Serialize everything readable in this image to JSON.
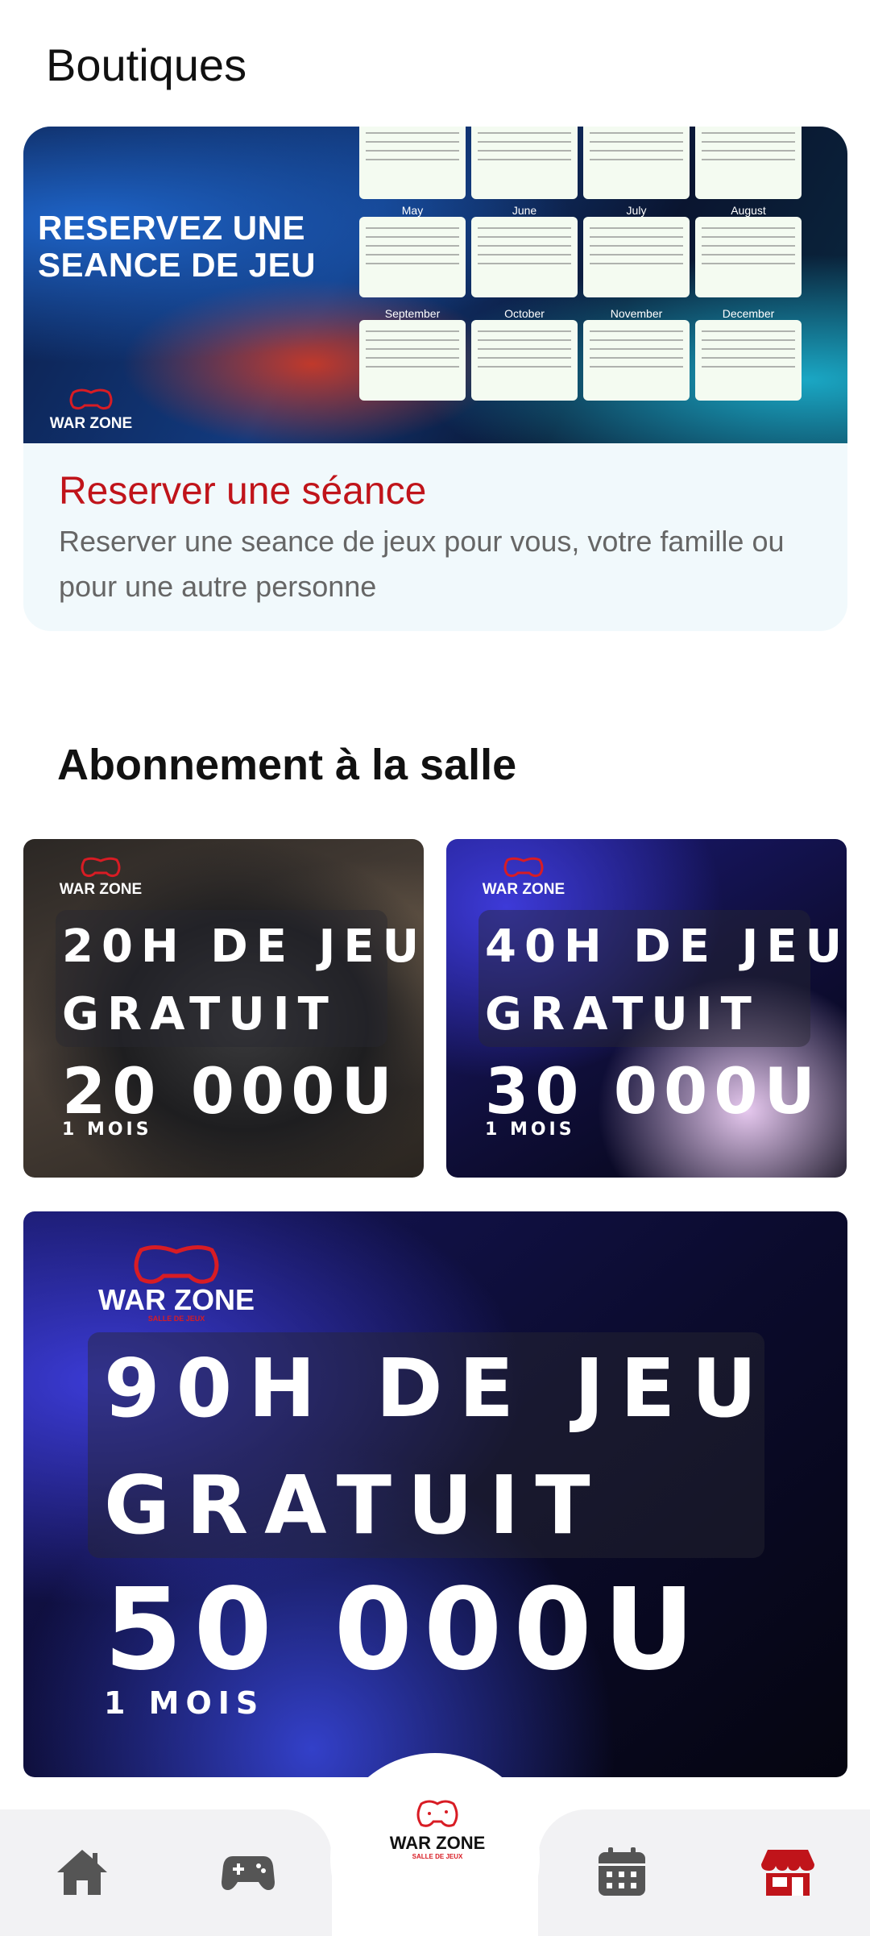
{
  "header": {
    "title": "Boutiques"
  },
  "reservation": {
    "banner_line1": "RESERVEZ UNE",
    "banner_line2": "SEANCE DE JEU",
    "brand": "WAR ZONE",
    "months": [
      "May",
      "June",
      "July",
      "August",
      "September",
      "October",
      "November",
      "December"
    ],
    "title": "Reserver une séance",
    "description": "Reserver une seance de jeux pour vous, votre famille ou pour une autre personne"
  },
  "subscriptions": {
    "section_title": "Abonnement à la salle",
    "plans": [
      {
        "brand": "WAR ZONE",
        "line1": "20H DE JEU",
        "line2": "GRATUIT",
        "price": "20 000U",
        "duration": "1 MOIS"
      },
      {
        "brand": "WAR ZONE",
        "line1": "40H DE JEU",
        "line2": "GRATUIT",
        "price": "30 000U",
        "duration": "1 MOIS"
      },
      {
        "brand": "WAR ZONE",
        "brand_sub": "SALLE DE JEUX",
        "line1": "90H DE JEU",
        "line2": "GRATUIT",
        "price": "50 000U",
        "duration": "1 MOIS"
      }
    ]
  },
  "nav": {
    "items": [
      {
        "icon": "home-icon",
        "active": false
      },
      {
        "icon": "gamepad-icon",
        "active": false
      },
      {
        "icon": "calendar-icon",
        "active": false
      },
      {
        "icon": "store-icon",
        "active": true
      }
    ],
    "center_brand": "WAR ZONE",
    "center_sub": "SALLE DE JEUX"
  },
  "colors": {
    "accent_red": "#c0141a",
    "nav_gray": "#555555",
    "background": "#ffffff"
  }
}
